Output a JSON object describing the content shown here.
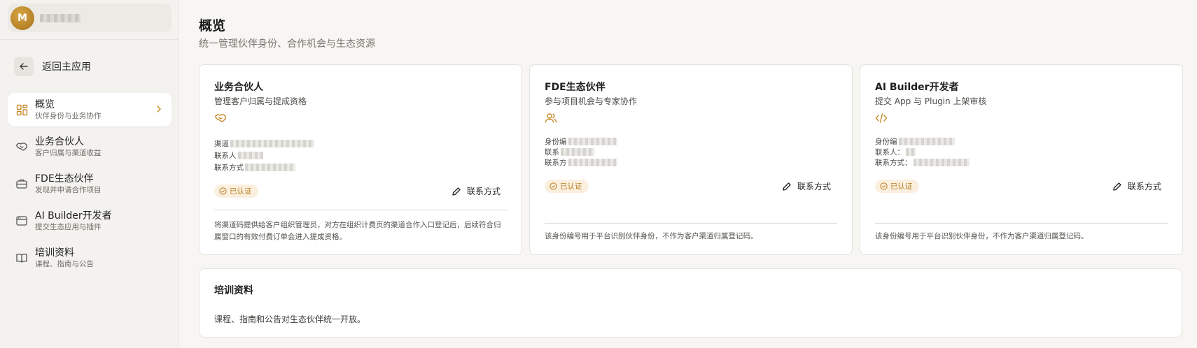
{
  "user": {
    "avatar_initial": "M"
  },
  "sidebar": {
    "back_label": "返回主应用",
    "items": [
      {
        "title": "概览",
        "subtitle": "伙伴身份与业务协作"
      },
      {
        "title": "业务合伙人",
        "subtitle": "客户归属与渠道收益"
      },
      {
        "title": "FDE生态伙伴",
        "subtitle": "发现并申请合作项目"
      },
      {
        "title": "AI Builder开发者",
        "subtitle": "提交生态应用与插件"
      },
      {
        "title": "培训资料",
        "subtitle": "课程、指南与公告"
      }
    ]
  },
  "page": {
    "title": "概览",
    "subtitle": "统一管理伙伴身份、合作机会与生态资源"
  },
  "cards": [
    {
      "title": "业务合伙人",
      "subtitle": "管理客户归属与提成资格",
      "icon": "handshake-icon",
      "fields": [
        "渠道",
        "联系人",
        "联系方式"
      ],
      "badge": "已认证",
      "contact_label": "联系方式",
      "note": "将渠道码提供给客户组织管理员，对方在组织计费页的渠道合作入口登记后，后续符合归属窗口的有效付费订单会进入提成资格。"
    },
    {
      "title": "FDE生态伙伴",
      "subtitle": "参与项目机会与专家协作",
      "icon": "users-icon",
      "fields": [
        "身份编",
        "联系",
        "联系方"
      ],
      "badge": "已认证",
      "contact_label": "联系方式",
      "note": "该身份编号用于平台识别伙伴身份，不作为客户渠道归属登记码。"
    },
    {
      "title": "AI Builder开发者",
      "subtitle": "提交 App 与 Plugin 上架审核",
      "icon": "code-icon",
      "fields": [
        "身份编",
        "联系人：",
        "联系方式："
      ],
      "badge": "已认证",
      "contact_label": "联系方式",
      "note": "该身份编号用于平台识别伙伴身份，不作为客户渠道归属登记码。"
    }
  ],
  "training": {
    "title": "培训资料",
    "description": "课程、指南和公告对生态伙伴统一开放。"
  },
  "colors": {
    "accent": "#c58a2a",
    "badge_bg": "#fbf0df"
  }
}
